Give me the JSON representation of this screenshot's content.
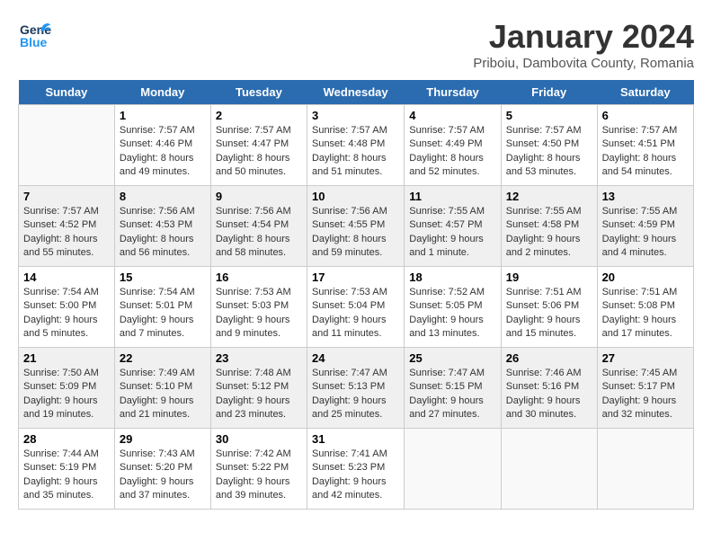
{
  "header": {
    "logo_line1": "General",
    "logo_line2": "Blue",
    "month": "January 2024",
    "location": "Priboiu, Dambovita County, Romania"
  },
  "days_of_week": [
    "Sunday",
    "Monday",
    "Tuesday",
    "Wednesday",
    "Thursday",
    "Friday",
    "Saturday"
  ],
  "weeks": [
    [
      {
        "day": null,
        "data": null
      },
      {
        "day": "1",
        "data": "Sunrise: 7:57 AM\nSunset: 4:46 PM\nDaylight: 8 hours\nand 49 minutes."
      },
      {
        "day": "2",
        "data": "Sunrise: 7:57 AM\nSunset: 4:47 PM\nDaylight: 8 hours\nand 50 minutes."
      },
      {
        "day": "3",
        "data": "Sunrise: 7:57 AM\nSunset: 4:48 PM\nDaylight: 8 hours\nand 51 minutes."
      },
      {
        "day": "4",
        "data": "Sunrise: 7:57 AM\nSunset: 4:49 PM\nDaylight: 8 hours\nand 52 minutes."
      },
      {
        "day": "5",
        "data": "Sunrise: 7:57 AM\nSunset: 4:50 PM\nDaylight: 8 hours\nand 53 minutes."
      },
      {
        "day": "6",
        "data": "Sunrise: 7:57 AM\nSunset: 4:51 PM\nDaylight: 8 hours\nand 54 minutes."
      }
    ],
    [
      {
        "day": "7",
        "data": "Sunrise: 7:57 AM\nSunset: 4:52 PM\nDaylight: 8 hours\nand 55 minutes."
      },
      {
        "day": "8",
        "data": "Sunrise: 7:56 AM\nSunset: 4:53 PM\nDaylight: 8 hours\nand 56 minutes."
      },
      {
        "day": "9",
        "data": "Sunrise: 7:56 AM\nSunset: 4:54 PM\nDaylight: 8 hours\nand 58 minutes."
      },
      {
        "day": "10",
        "data": "Sunrise: 7:56 AM\nSunset: 4:55 PM\nDaylight: 8 hours\nand 59 minutes."
      },
      {
        "day": "11",
        "data": "Sunrise: 7:55 AM\nSunset: 4:57 PM\nDaylight: 9 hours\nand 1 minute."
      },
      {
        "day": "12",
        "data": "Sunrise: 7:55 AM\nSunset: 4:58 PM\nDaylight: 9 hours\nand 2 minutes."
      },
      {
        "day": "13",
        "data": "Sunrise: 7:55 AM\nSunset: 4:59 PM\nDaylight: 9 hours\nand 4 minutes."
      }
    ],
    [
      {
        "day": "14",
        "data": "Sunrise: 7:54 AM\nSunset: 5:00 PM\nDaylight: 9 hours\nand 5 minutes."
      },
      {
        "day": "15",
        "data": "Sunrise: 7:54 AM\nSunset: 5:01 PM\nDaylight: 9 hours\nand 7 minutes."
      },
      {
        "day": "16",
        "data": "Sunrise: 7:53 AM\nSunset: 5:03 PM\nDaylight: 9 hours\nand 9 minutes."
      },
      {
        "day": "17",
        "data": "Sunrise: 7:53 AM\nSunset: 5:04 PM\nDaylight: 9 hours\nand 11 minutes."
      },
      {
        "day": "18",
        "data": "Sunrise: 7:52 AM\nSunset: 5:05 PM\nDaylight: 9 hours\nand 13 minutes."
      },
      {
        "day": "19",
        "data": "Sunrise: 7:51 AM\nSunset: 5:06 PM\nDaylight: 9 hours\nand 15 minutes."
      },
      {
        "day": "20",
        "data": "Sunrise: 7:51 AM\nSunset: 5:08 PM\nDaylight: 9 hours\nand 17 minutes."
      }
    ],
    [
      {
        "day": "21",
        "data": "Sunrise: 7:50 AM\nSunset: 5:09 PM\nDaylight: 9 hours\nand 19 minutes."
      },
      {
        "day": "22",
        "data": "Sunrise: 7:49 AM\nSunset: 5:10 PM\nDaylight: 9 hours\nand 21 minutes."
      },
      {
        "day": "23",
        "data": "Sunrise: 7:48 AM\nSunset: 5:12 PM\nDaylight: 9 hours\nand 23 minutes."
      },
      {
        "day": "24",
        "data": "Sunrise: 7:47 AM\nSunset: 5:13 PM\nDaylight: 9 hours\nand 25 minutes."
      },
      {
        "day": "25",
        "data": "Sunrise: 7:47 AM\nSunset: 5:15 PM\nDaylight: 9 hours\nand 27 minutes."
      },
      {
        "day": "26",
        "data": "Sunrise: 7:46 AM\nSunset: 5:16 PM\nDaylight: 9 hours\nand 30 minutes."
      },
      {
        "day": "27",
        "data": "Sunrise: 7:45 AM\nSunset: 5:17 PM\nDaylight: 9 hours\nand 32 minutes."
      }
    ],
    [
      {
        "day": "28",
        "data": "Sunrise: 7:44 AM\nSunset: 5:19 PM\nDaylight: 9 hours\nand 35 minutes."
      },
      {
        "day": "29",
        "data": "Sunrise: 7:43 AM\nSunset: 5:20 PM\nDaylight: 9 hours\nand 37 minutes."
      },
      {
        "day": "30",
        "data": "Sunrise: 7:42 AM\nSunset: 5:22 PM\nDaylight: 9 hours\nand 39 minutes."
      },
      {
        "day": "31",
        "data": "Sunrise: 7:41 AM\nSunset: 5:23 PM\nDaylight: 9 hours\nand 42 minutes."
      },
      {
        "day": null,
        "data": null
      },
      {
        "day": null,
        "data": null
      },
      {
        "day": null,
        "data": null
      }
    ]
  ]
}
